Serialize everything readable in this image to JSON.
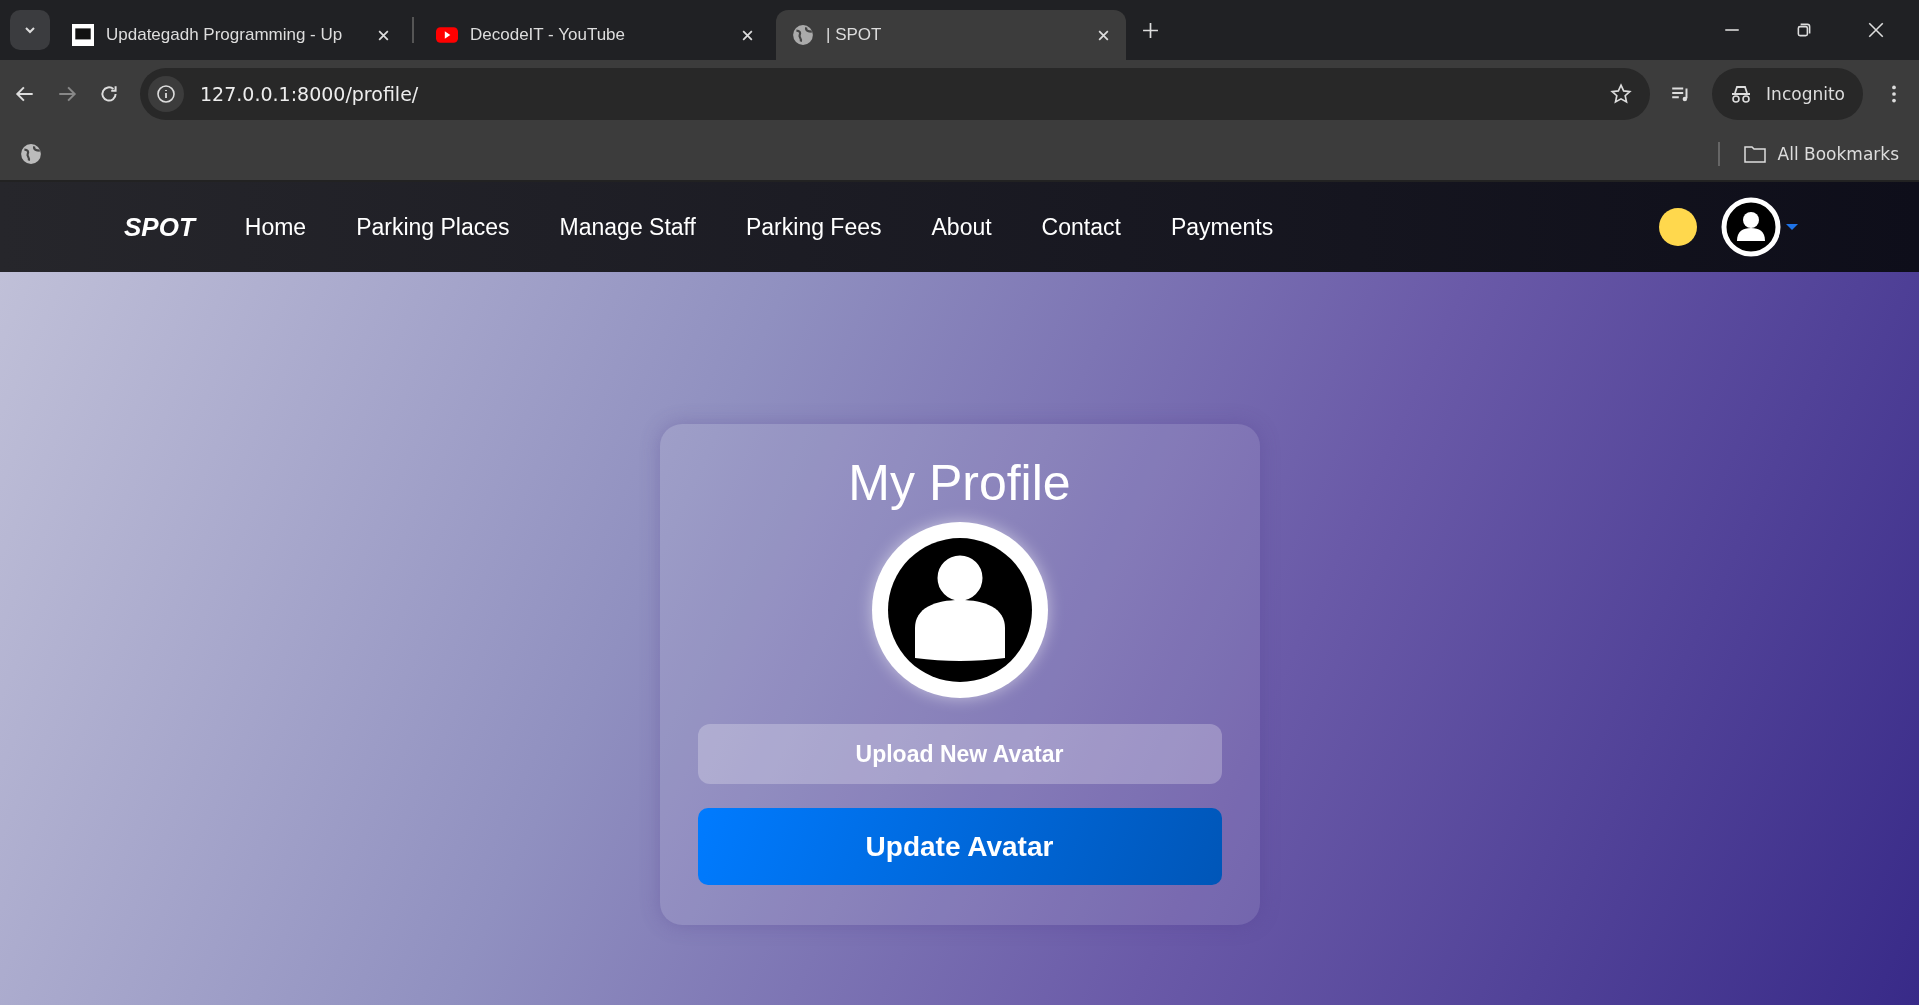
{
  "browser": {
    "tabs": [
      {
        "title": "Updategadh Programming - Up",
        "selected": false
      },
      {
        "title": "DecodeIT - YouTube",
        "selected": false
      },
      {
        "title": "| SPOT",
        "selected": true
      }
    ],
    "address": "127.0.0.1:8000/profile/",
    "profile_label": "Incognito",
    "bookmarks": "All Bookmarks"
  },
  "navbar": {
    "logo": "SPOT",
    "links": [
      "Home",
      "Parking Places",
      "Manage Staff",
      "Parking Fees",
      "About",
      "Contact",
      "Payments"
    ]
  },
  "profile_card": {
    "title": "My Profile",
    "upload_button": "Upload New Avatar",
    "update_button": "Update Avatar"
  }
}
